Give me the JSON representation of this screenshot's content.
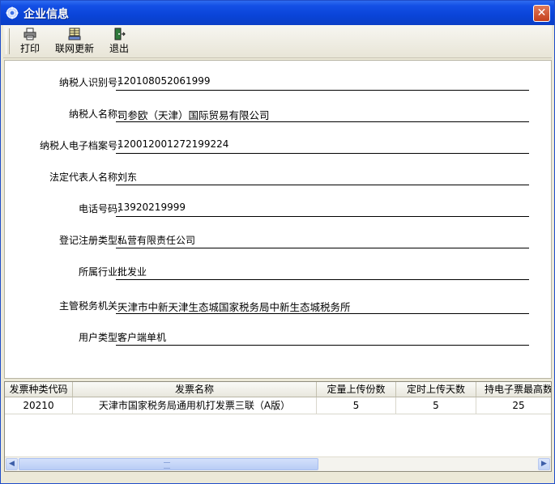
{
  "window": {
    "title": "企业信息",
    "close_symbol": "✕"
  },
  "toolbar": {
    "print_label": "打印",
    "update_label": "联网更新",
    "exit_label": "退出"
  },
  "info": {
    "fields": [
      {
        "label": "纳税人识别号:",
        "value": "120108052061999"
      },
      {
        "label": "纳税人名称:",
        "value": "司参欧（天津）国际贸易有限公司"
      },
      {
        "label": "纳税人电子档案号:",
        "value": "120012001272199224"
      },
      {
        "label": "法定代表人名称:",
        "value": "刘东"
      },
      {
        "label": "电话号码:",
        "value": "13920219999"
      },
      {
        "label": "登记注册类型:",
        "value": "私营有限责任公司"
      },
      {
        "label": "所属行业:",
        "value": "批发业"
      },
      {
        "label": "主管税务机关:",
        "value": "天津市中新天津生态城国家税务局中新生态城税务所"
      },
      {
        "label": "用户类型:",
        "value": "客户端单机"
      }
    ]
  },
  "invoice_table": {
    "columns": [
      "发票种类代码",
      "发票名称",
      "定量上传份数",
      "定时上传天数",
      "持电子票最高数"
    ],
    "rows": [
      [
        "20210",
        "天津市国家税务局通用机打发票三联（A版）",
        "5",
        "5",
        "25"
      ]
    ]
  },
  "colors": {
    "titlebar": "#0a44d8",
    "window_bg": "#ece9d8",
    "close_button": "#c4401c"
  }
}
